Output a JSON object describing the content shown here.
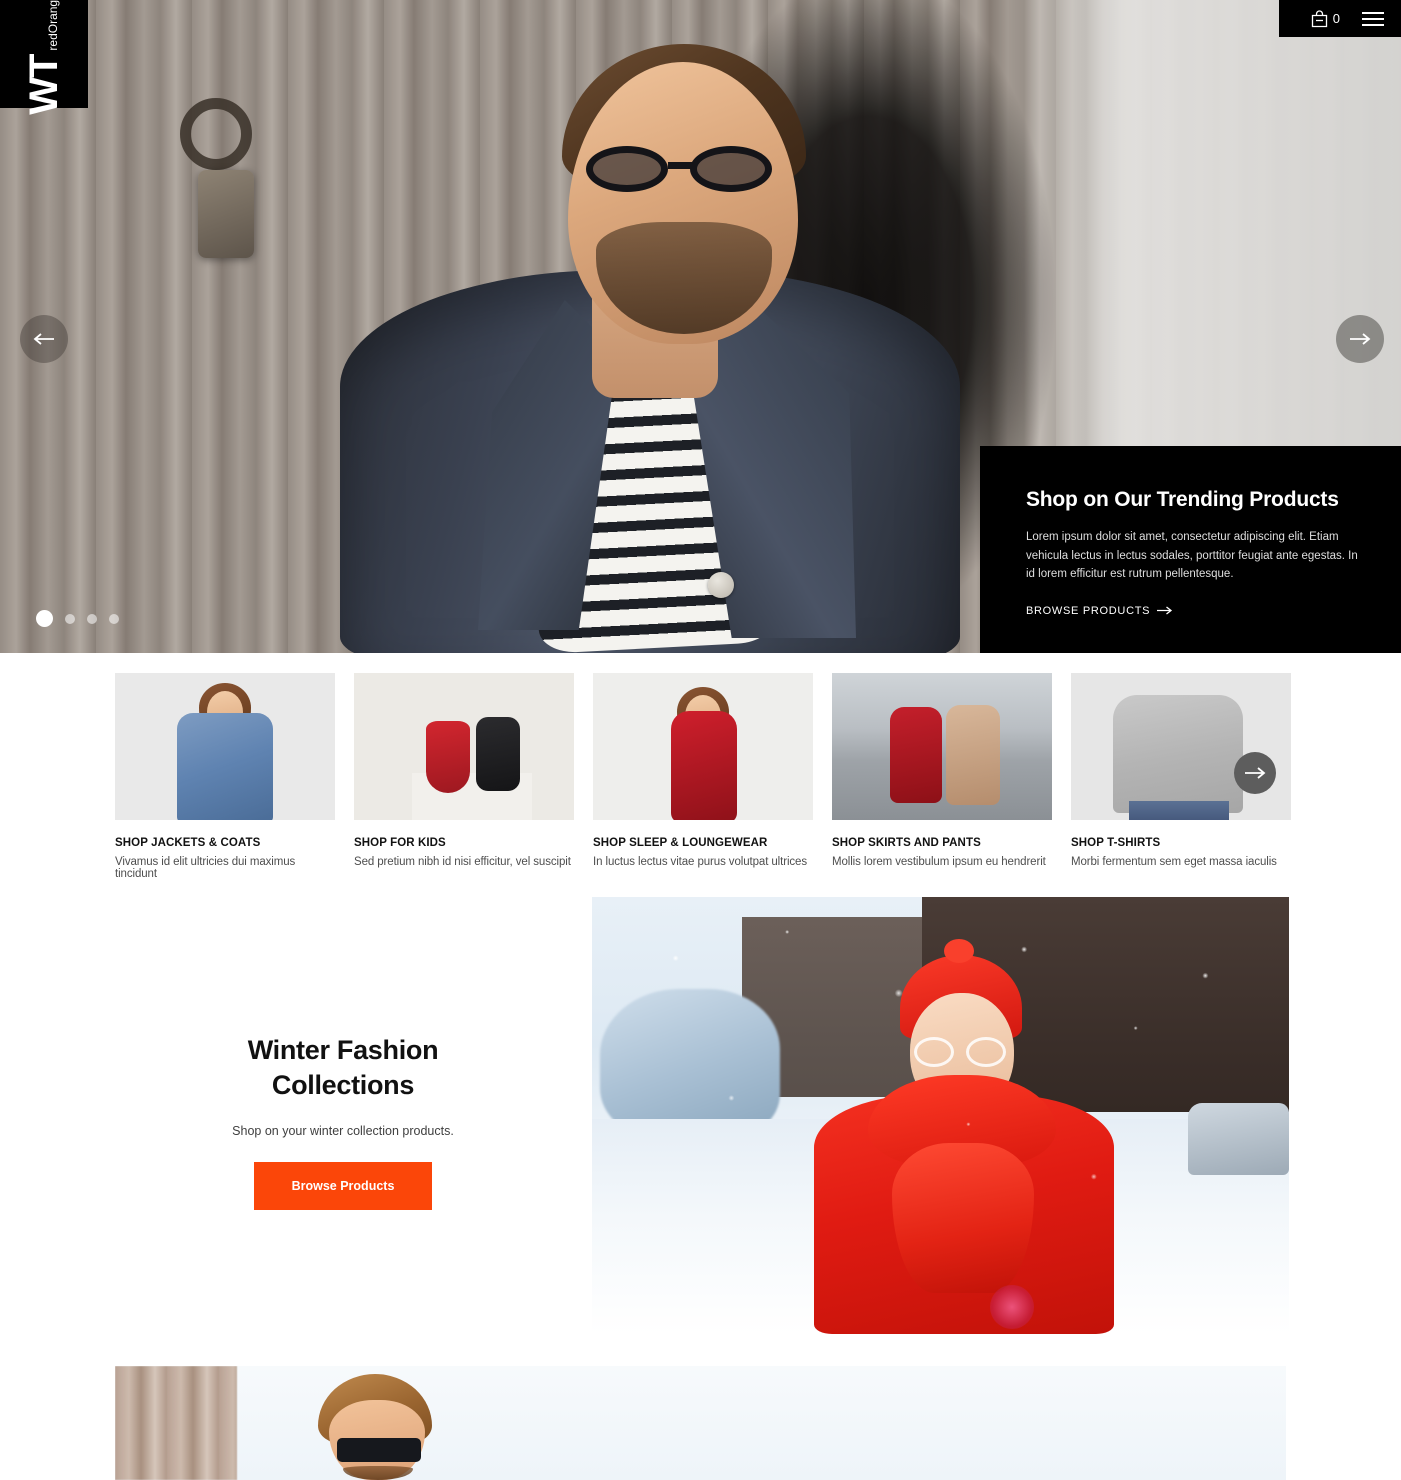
{
  "brand": {
    "logo_mark": "WT",
    "logo_sub": "redOrange"
  },
  "header": {
    "cart_icon": "shopping-bag-icon",
    "cart_count": "0",
    "menu_icon": "hamburger-menu-icon"
  },
  "hero": {
    "prev_icon": "arrow-left-icon",
    "next_icon": "arrow-right-icon",
    "dots": [
      "slide-1",
      "slide-2",
      "slide-3",
      "slide-4"
    ],
    "active_dot_index": 0,
    "promo": {
      "title": "Shop on Our Trending Products",
      "text": "Lorem ipsum dolor sit amet, consectetur adipiscing elit. Etiam vehicula lectus in lectus sodales, porttitor feugiat ante egestas. In id lorem efficitur est rutrum pellentesque.",
      "link_label": "BROWSE PRODUCTS",
      "link_arrow": "→"
    }
  },
  "categories": {
    "next_icon": "arrow-right-icon",
    "items": [
      {
        "name": "SHOP JACKETS & COATS",
        "desc": "Vivamus id elit ultricies dui maximus tincidunt"
      },
      {
        "name": "SHOP FOR KIDS",
        "desc": "Sed pretium nibh id nisi efficitur, vel suscipit"
      },
      {
        "name": "SHOP SLEEP & LOUNGEWEAR",
        "desc": "In luctus lectus vitae purus volutpat ultrices"
      },
      {
        "name": "SHOP SKIRTS AND PANTS",
        "desc": "Mollis lorem vestibulum ipsum eu hendrerit"
      },
      {
        "name": "SHOP T-SHIRTS",
        "desc": "Morbi fermentum sem eget massa iaculis"
      }
    ]
  },
  "winter": {
    "title_line1": "Winter Fashion",
    "title_line2": "Collections",
    "subtitle": "Shop on your winter collection products.",
    "button_label": "Browse Products"
  },
  "colors": {
    "accent_orange": "#FB4609",
    "black": "#000000",
    "text_dark": "#111111",
    "text_muted": "#4E4E4E",
    "card_bg": "#E9E9E9",
    "arrow_button": "#5D5D5D"
  }
}
